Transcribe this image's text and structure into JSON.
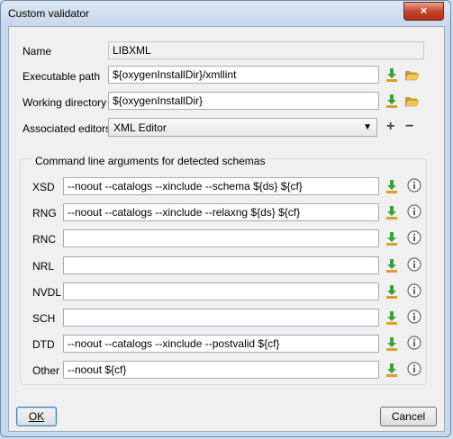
{
  "window": {
    "title": "Custom validator",
    "close_glyph": "×"
  },
  "form": {
    "name": {
      "label": "Name",
      "value": "LIBXML"
    },
    "executable": {
      "label": "Executable path",
      "value": "${oxygenInstallDir}/xmllint"
    },
    "working": {
      "label": "Working directory",
      "value": "${oxygenInstallDir}"
    },
    "editors": {
      "label": "Associated editors",
      "value": "XML Editor",
      "add_glyph": "+",
      "remove_glyph": "−"
    }
  },
  "schemas": {
    "title": "Command line arguments for detected schemas",
    "rows": [
      {
        "label": "XSD",
        "value": "--noout --catalogs --xinclude --schema ${ds} ${cf}"
      },
      {
        "label": "RNG",
        "value": "--noout --catalogs --xinclude --relaxng ${ds} ${cf}"
      },
      {
        "label": "RNC",
        "value": ""
      },
      {
        "label": "NRL",
        "value": ""
      },
      {
        "label": "NVDL",
        "value": ""
      },
      {
        "label": "SCH",
        "value": ""
      },
      {
        "label": "DTD",
        "value": "--noout --catalogs --xinclude --postvalid ${cf}"
      },
      {
        "label": "Other",
        "value": "--noout ${cf}"
      }
    ]
  },
  "buttons": {
    "ok": "OK",
    "cancel": "Cancel"
  },
  "colors": {
    "download_arrow": "#39a139",
    "folder": "#e3b44a",
    "close": "#c7452c"
  }
}
